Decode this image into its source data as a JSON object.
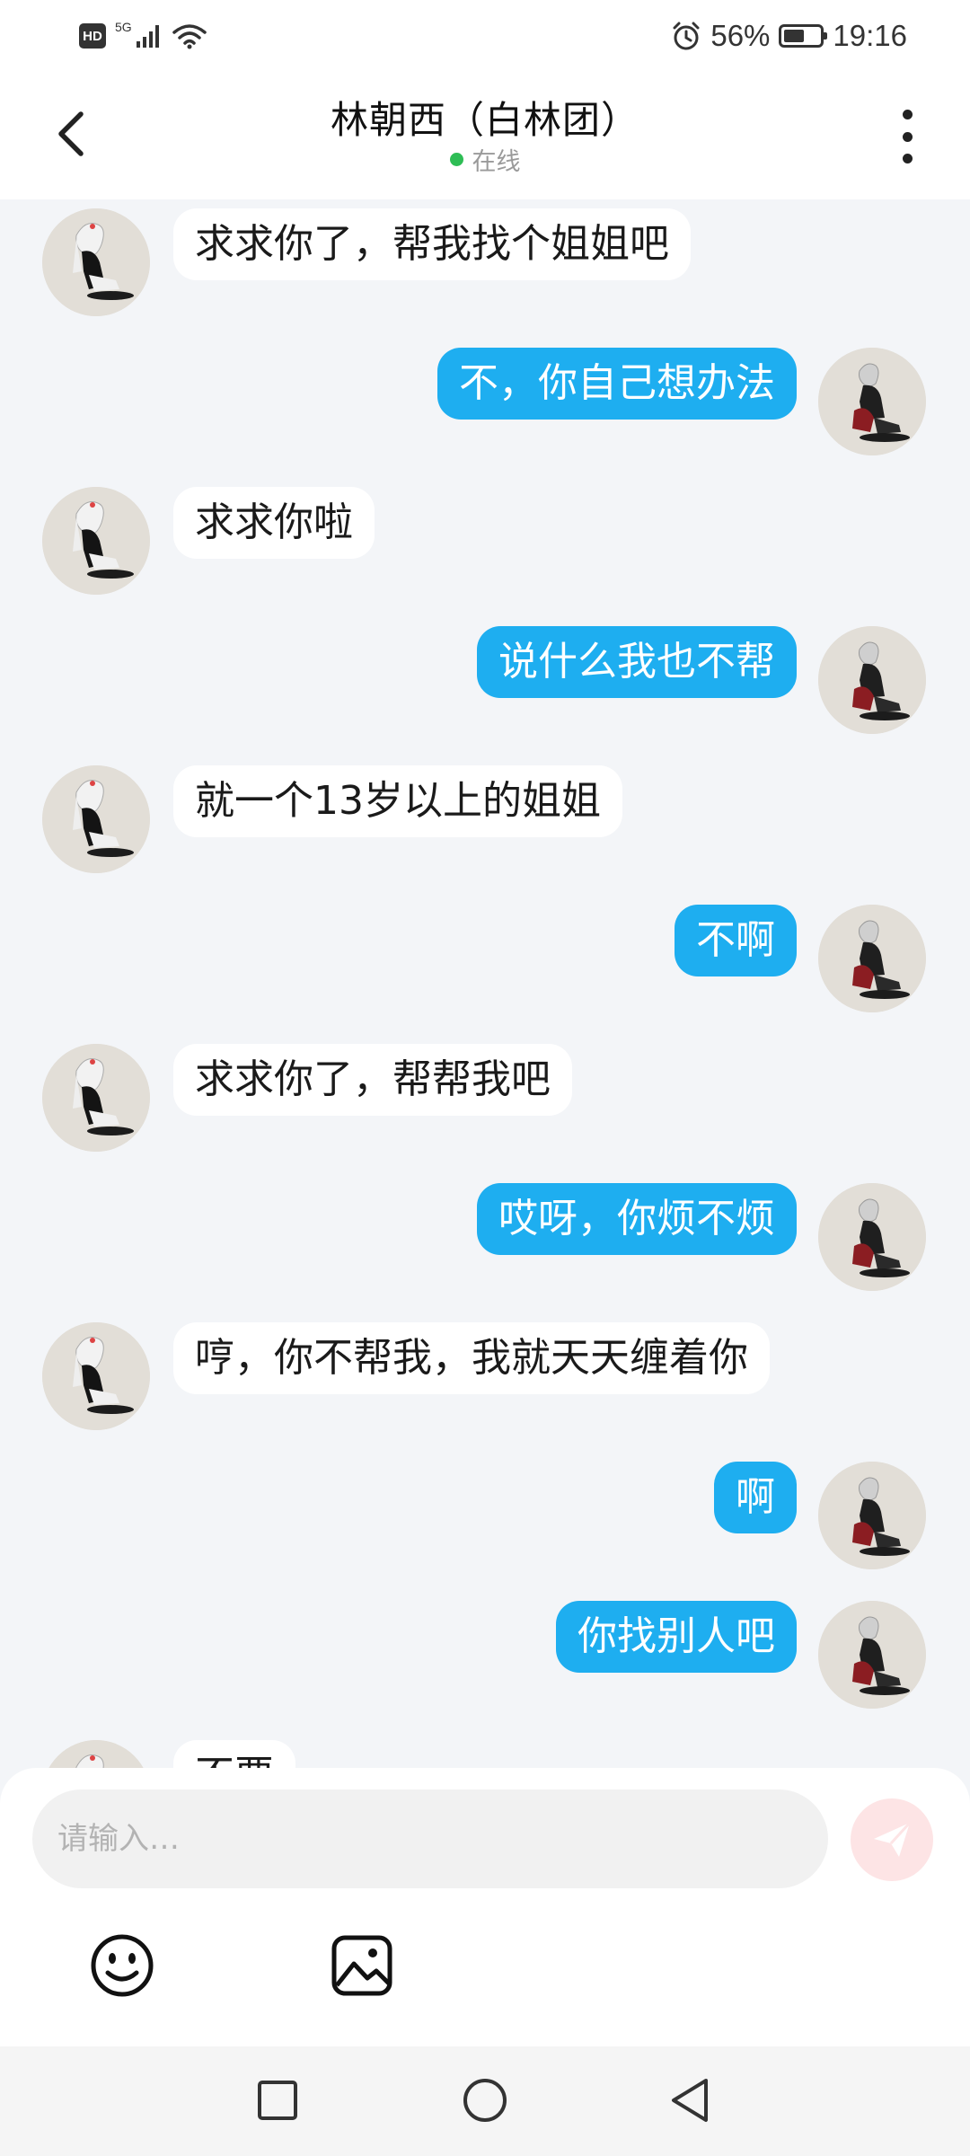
{
  "status_bar": {
    "network_badge": "HD",
    "network_type": "5G",
    "battery": "56%",
    "battery_level": 0.56,
    "time": "19:16",
    "icons": [
      "signal-icon",
      "wifi-icon",
      "alarm-icon",
      "battery-icon"
    ]
  },
  "header": {
    "title": "林朝西（白林团）",
    "status": "在线",
    "online_color": "#2ebd55",
    "icons": [
      "back-arrow-icon",
      "more-vertical-icon"
    ]
  },
  "messages": [
    {
      "side": "left",
      "text": "求求你了，帮我找个姐姐吧"
    },
    {
      "side": "right",
      "text": "不，你自己想办法"
    },
    {
      "side": "left",
      "text": "求求你啦"
    },
    {
      "side": "right",
      "text": "说什么我也不帮"
    },
    {
      "side": "left",
      "text": "就一个13岁以上的姐姐"
    },
    {
      "side": "right",
      "text": "不啊"
    },
    {
      "side": "left",
      "text": "求求你了，帮帮我吧"
    },
    {
      "side": "right",
      "text": "哎呀，你烦不烦"
    },
    {
      "side": "left",
      "text": "哼，你不帮我，我就天天缠着你"
    },
    {
      "side": "right",
      "text": "啊"
    },
    {
      "side": "right",
      "text": "你找别人吧"
    },
    {
      "side": "left",
      "text": "不要"
    }
  ],
  "colors": {
    "sent_bubble": "#1eaef0",
    "received_bubble": "#ffffff",
    "chat_background": "#f3f5f8",
    "send_button": "#fde4e5"
  },
  "input": {
    "placeholder": "请输入…",
    "value": ""
  },
  "toolbar": {
    "icons": [
      "emoji-icon",
      "image-icon",
      "send-icon"
    ]
  },
  "nav": {
    "icons": [
      "recent-apps-icon",
      "home-icon",
      "back-icon"
    ]
  }
}
